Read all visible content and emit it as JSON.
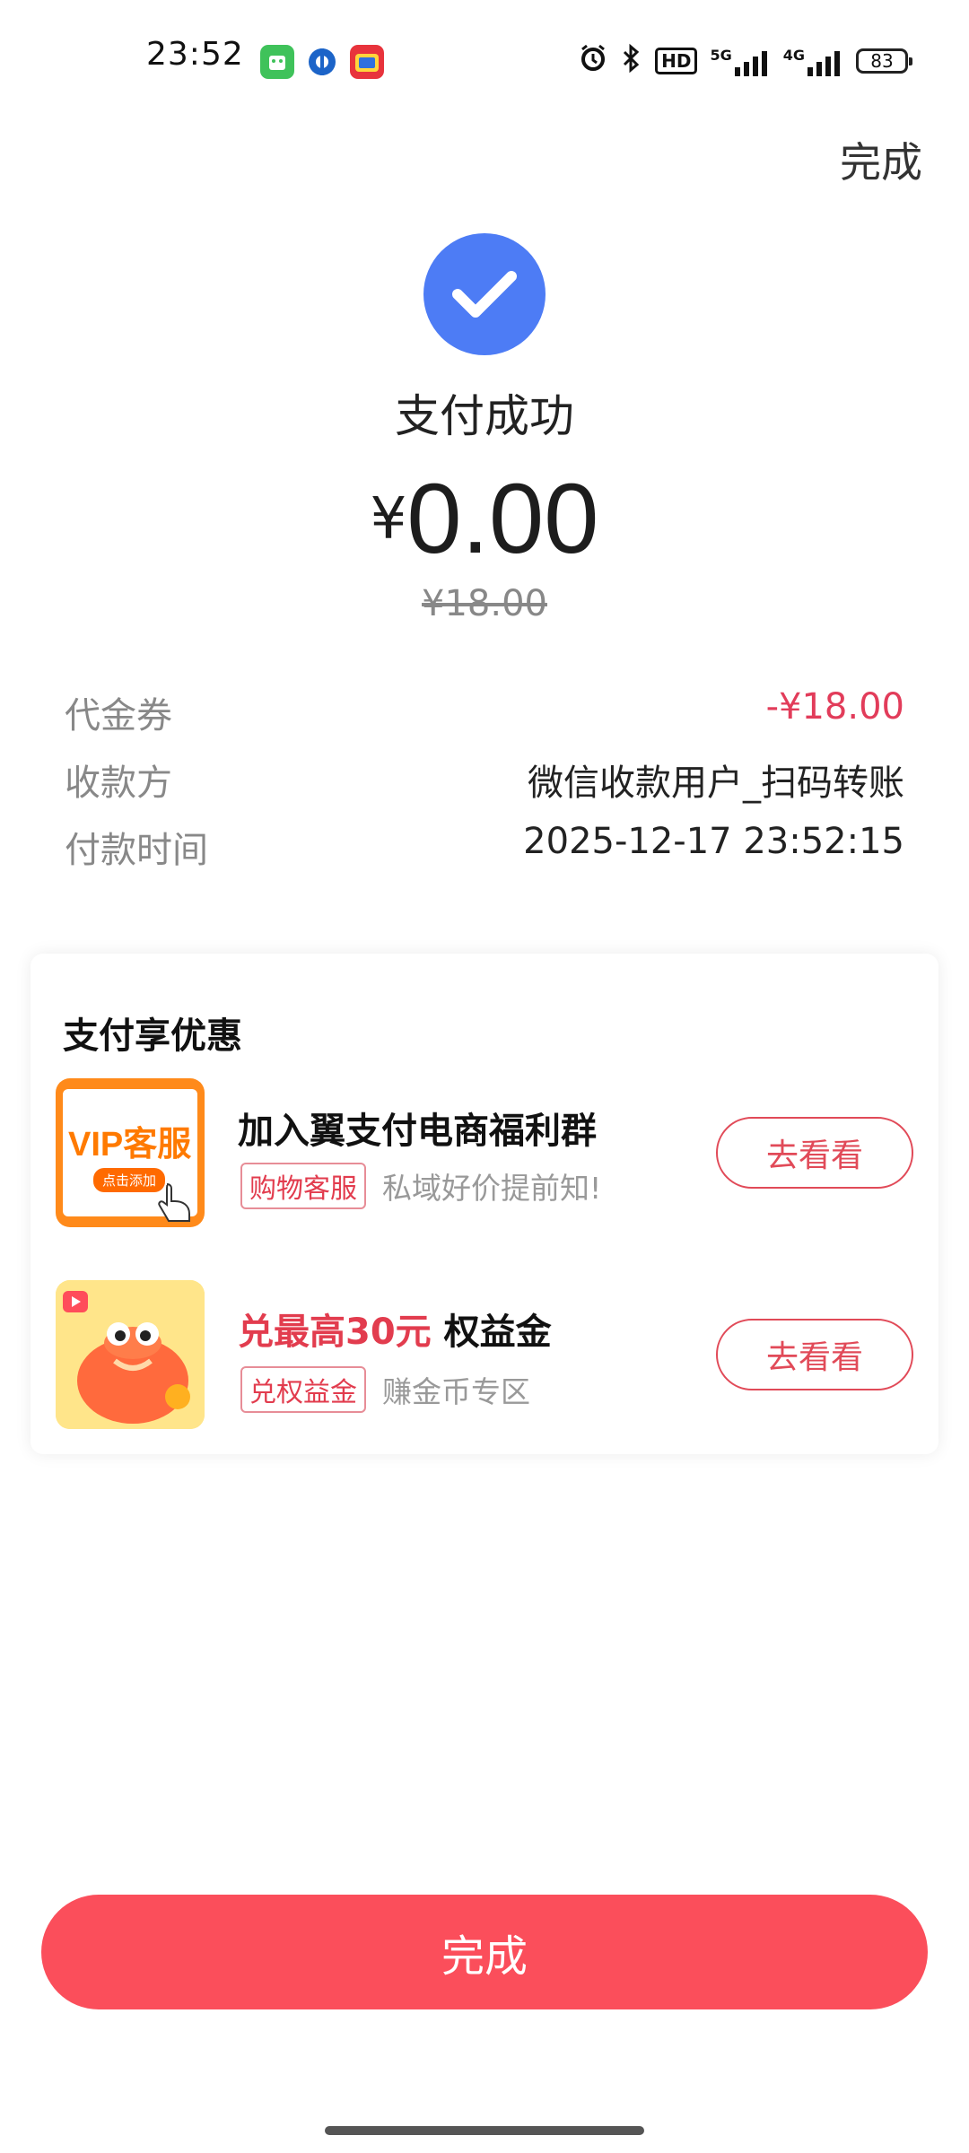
{
  "status_bar": {
    "time": "23:52",
    "network_hd": "HD",
    "network_5g": "5G",
    "network_4g": "4G",
    "battery": "83"
  },
  "header": {
    "done_label": "完成"
  },
  "result": {
    "status_text": "支付成功",
    "currency": "¥",
    "amount": "0.00",
    "original_amount": "¥18.00"
  },
  "details": [
    {
      "label": "代金券",
      "value": "-¥18.00",
      "value_color": "#e23c5a"
    },
    {
      "label": "收款方",
      "value": "微信收款用户_扫码转账",
      "value_color": "#222222"
    },
    {
      "label": "付款时间",
      "value": "2025-12-17 23:52:15",
      "value_color": "#222222"
    }
  ],
  "promo": {
    "title": "支付享优惠",
    "items": [
      {
        "thumb_main": "VIP客服",
        "thumb_sub": "点击添加",
        "title": "加入翼支付电商福利群",
        "tag": "购物客服",
        "subtitle": "私域好价提前知!",
        "button": "去看看"
      },
      {
        "title_highlight": "兑最高30元",
        "title_rest": " 权益金",
        "tag": "兑权益金",
        "subtitle": "赚金币专区",
        "button": "去看看"
      }
    ]
  },
  "footer": {
    "done_button": "完成"
  },
  "colors": {
    "accent": "#fb4e5b",
    "check": "#4d7cf5",
    "highlight": "#e23c4e"
  }
}
